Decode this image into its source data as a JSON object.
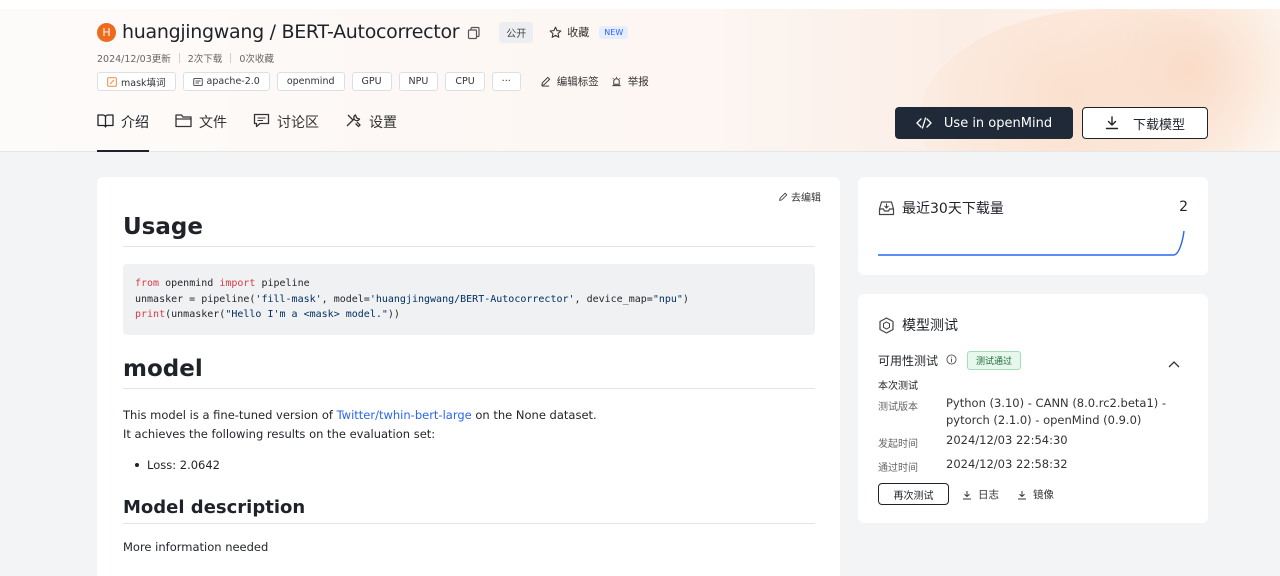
{
  "repo": {
    "avatar_letter": "H",
    "title": "huangjingwang / BERT-Autocorrector",
    "visibility": "公开",
    "star_label": "收藏",
    "new_badge": "NEW",
    "updated": "2024/12/03更新",
    "downloads": "2次下载",
    "favorites": "0次收藏"
  },
  "tags": {
    "items": [
      "mask填词",
      "apache-2.0",
      "openmind",
      "GPU",
      "NPU",
      "CPU"
    ],
    "more": "···",
    "edit_tags": "编辑标签",
    "report": "举报"
  },
  "tabs": [
    "介绍",
    "文件",
    "讨论区",
    "设置"
  ],
  "actions": {
    "use_openmind": "Use in openMind",
    "download_model": "下载模型"
  },
  "readme": {
    "edit_link": "去编辑",
    "usage_heading": "Usage",
    "code": {
      "line1": {
        "kw1": "from",
        "mod": " openmind ",
        "kw2": "import",
        "rest": " pipeline"
      },
      "line2": {
        "pre": "unmasker = pipeline(",
        "s1": "'fill-mask'",
        "mid": ", model=",
        "s2": "'huangjingwang/BERT-Autocorrector'",
        "mid2": ", device_map=",
        "s3": "\"npu\"",
        "end": ")"
      },
      "line3": {
        "kw": "print",
        "pre": "(unmasker(",
        "s": "\"Hello I'm a <mask> model.\"",
        "end": "))"
      }
    },
    "model_heading": "model",
    "para1_pre": "This model is a fine-tuned version of ",
    "para1_link": "Twitter/twhin-bert-large",
    "para1_post": " on the None dataset.",
    "para2": "It achieves the following results on the evaluation set:",
    "bullet1": "Loss: 2.0642",
    "desc_heading": "Model description",
    "desc_text": "More information needed"
  },
  "downloads_card": {
    "title": "最近30天下载量",
    "count": "2",
    "chart_data": {
      "type": "line",
      "values": [
        0,
        0,
        0,
        0,
        0,
        0,
        0,
        0,
        0,
        0,
        0,
        0,
        0,
        0,
        0,
        0,
        0,
        0,
        0,
        0,
        0,
        0,
        0,
        0,
        0,
        0,
        0,
        0,
        0,
        2
      ],
      "color": "#2a66f2"
    }
  },
  "test_card": {
    "title": "模型测试",
    "availability_label": "可用性测试",
    "status_badge": "测试通过",
    "this_test": "本次测试",
    "version_label": "测试版本",
    "version_value": "Python (3.10) - CANN (8.0.rc2.beta1) - pytorch (2.1.0) - openMind (0.9.0)",
    "start_label": "发起时间",
    "start_value": "2024/12/03 22:54:30",
    "pass_label": "通过时间",
    "pass_value": "2024/12/03 22:58:32",
    "retest_button": "再次测试",
    "log_link": "日志",
    "image_link": "镜像"
  }
}
